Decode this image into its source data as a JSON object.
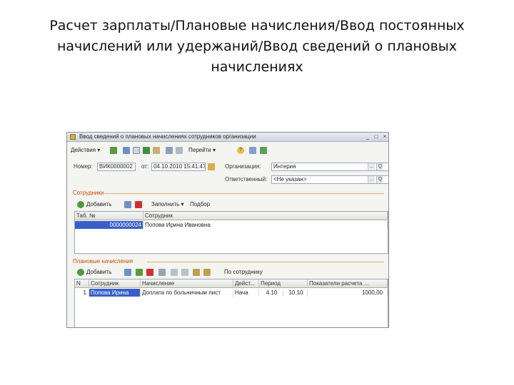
{
  "slide": {
    "title_line1": "Расчет зарплаты/Плановые начисления/Ввод постоянных",
    "title_line2": "начислений или удержаний/Ввод сведений о плановых",
    "title_line3": "начислениях"
  },
  "window": {
    "title": "Ввод сведений о плановых начислениях сотрудников организации",
    "minimize": "_",
    "maximize": "□",
    "close": "×"
  },
  "toolbar": {
    "actions": "Действия",
    "go_to": "Перейти",
    "dropdown": "▾",
    "help": "?"
  },
  "header": {
    "number_label": "Номер:",
    "number_value": "ВИК0000002",
    "from_label": "от:",
    "date_value": "04.10.2010 15:41:47",
    "org_label": "Организация:",
    "org_value": "Интерия",
    "org_btn1": "…",
    "org_btn2": "Q",
    "comment_label": "Ответственный:",
    "comment_value": "<Не указан>",
    "comment_btn1": "…",
    "comment_btn2": "Q"
  },
  "employees": {
    "section_title": "Сотрудники",
    "add": "Добавить",
    "fill": "Заполнить",
    "selection": "Подбор",
    "columns": [
      "Таб. №",
      "Сотрудник"
    ],
    "rows": [
      {
        "tab": "0000000024",
        "name": "Попова Ирина Ивановна"
      }
    ]
  },
  "accruals": {
    "section_title": "Плановые начисления",
    "add": "Добавить",
    "by_employee": "По сотруднику",
    "columns": [
      "N",
      "Сотрудник",
      "Начисление",
      "Дейст...",
      "Период",
      "Показатели расчета ..."
    ],
    "rows": [
      {
        "n": "1",
        "employee": "Попова Ирина",
        "accrual": "Доплата по больничным лист",
        "action": "Нача",
        "period": "4.10",
        "from": "10.10",
        "indicator": "1000,00"
      }
    ]
  }
}
